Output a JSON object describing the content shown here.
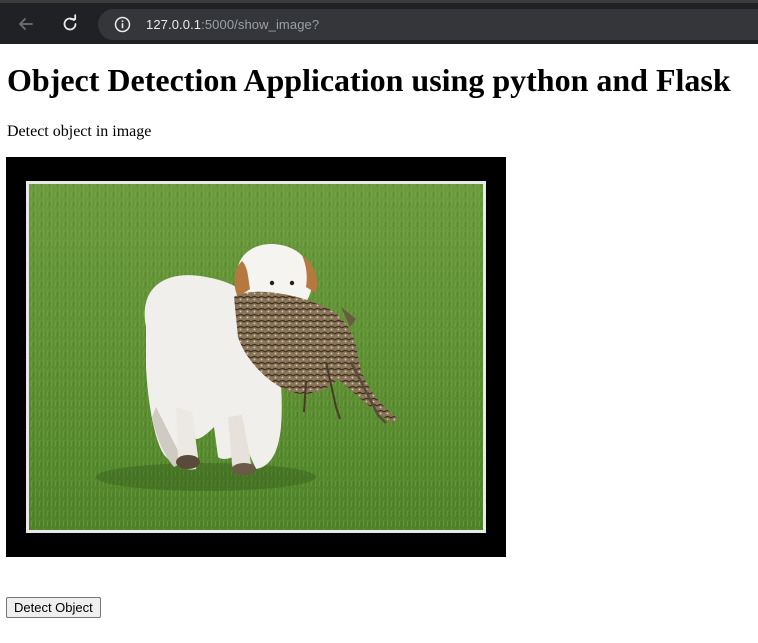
{
  "browser": {
    "url_host": "127.0.0.1",
    "url_path": ":5000/show_image?",
    "icons": {
      "back": "back-arrow-icon",
      "reload": "reload-icon",
      "info": "info-icon"
    }
  },
  "page": {
    "title": "Object Detection Application using python and Flask",
    "subtitle": "Detect object in image",
    "detect_button_label": "Detect Object"
  },
  "image": {
    "subject": "dog carrying pheasant on grass",
    "frame_color": "#000000",
    "mat_color": "#e8e8e8"
  }
}
